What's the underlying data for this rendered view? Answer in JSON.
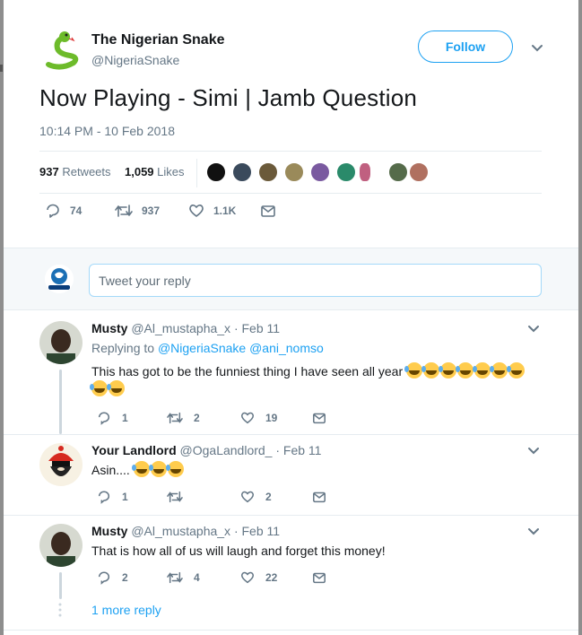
{
  "tweet": {
    "author_name": "The Nigerian Snake",
    "author_handle": "@NigeriaSnake",
    "follow_label": "Follow",
    "text": "Now Playing - Simi | Jamb Question",
    "time": "10:14 PM - 10 Feb 2018",
    "retweets_count": "937",
    "retweets_label": "Retweets",
    "likes_count": "1,059",
    "likes_label": "Likes",
    "actions": {
      "replies": "74",
      "retweets": "937",
      "likes": "1.1K"
    }
  },
  "reply_composer": {
    "placeholder": "Tweet your reply"
  },
  "replies": [
    {
      "name": "Musty",
      "meta": "@Al_mustapha_x · Feb 11",
      "replying_to_prefix": "Replying to",
      "replying_to_1": "@NigeriaSnake",
      "replying_to_2": "@ani_nomso",
      "text": "This has got to be the funniest thing I have seen all year",
      "emoji_count": 9,
      "replies": "1",
      "retweets": "2",
      "likes": "19"
    },
    {
      "name": "Your Landlord",
      "meta": "@OgaLandlord_ · Feb 11",
      "text": "Asin....",
      "emoji_count": 3,
      "replies": "1",
      "retweets": "",
      "likes": "2"
    },
    {
      "name": "Musty",
      "meta": "@Al_mustapha_x · Feb 11",
      "text": "That is how all of us will laugh and forget this money!",
      "replies": "2",
      "retweets": "4",
      "likes": "22"
    }
  ],
  "more_replies": "1 more reply",
  "colors": {
    "accent": "#1da1f2",
    "secondary_text": "#657786",
    "primary_text": "#14171a"
  },
  "icons": [
    "snake-avatar",
    "chevron-down-icon",
    "reply-icon",
    "retweet-icon",
    "like-icon",
    "dm-icon"
  ]
}
